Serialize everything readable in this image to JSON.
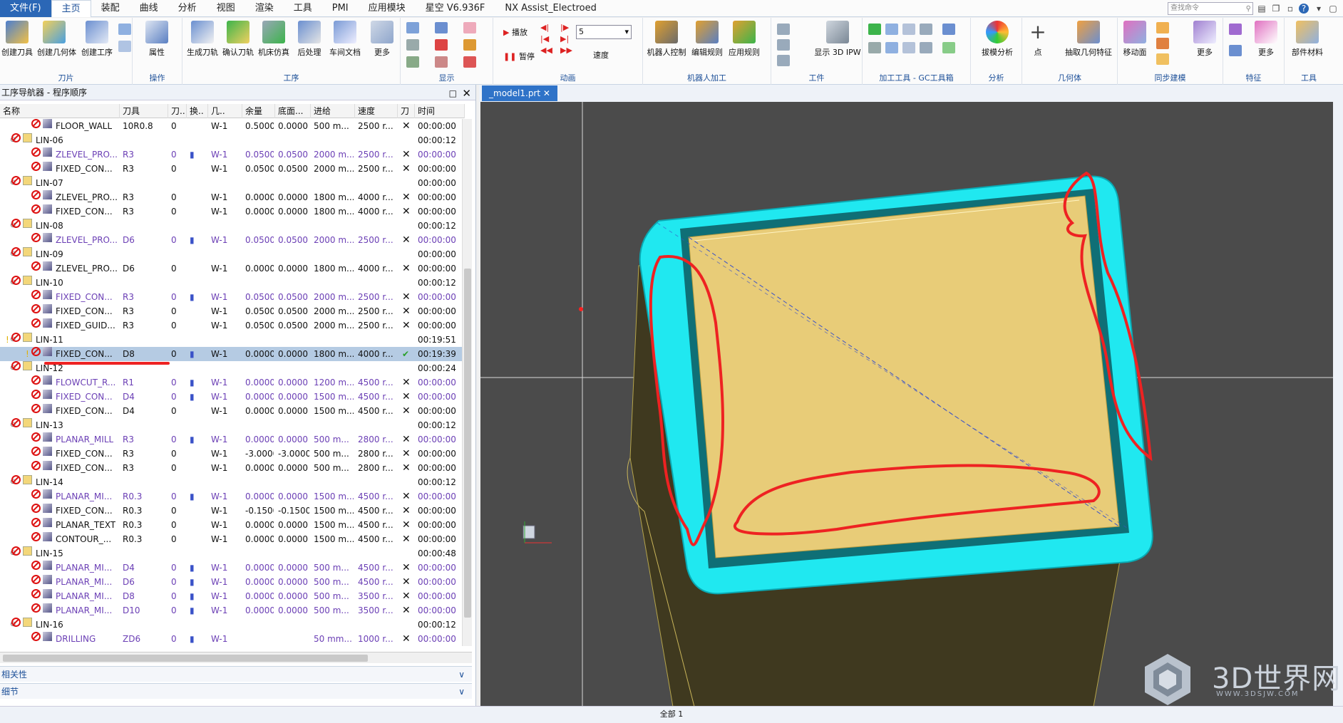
{
  "menubar": {
    "file": "文件(F)",
    "tabs": [
      "主页",
      "装配",
      "曲线",
      "分析",
      "视图",
      "渲染",
      "工具",
      "PMI",
      "应用模块",
      "星空 V6.936F",
      "NX Assist_Electroed"
    ],
    "search_placeholder": "查找命令"
  },
  "ribbon": {
    "groups": [
      {
        "label": "刀片",
        "buttons": [
          "创建刀具",
          "创建几何体",
          "创建工序"
        ]
      },
      {
        "label": "操作",
        "buttons": [
          "属性"
        ]
      },
      {
        "label": "工序",
        "buttons": [
          "生成刀轨",
          "确认刀轨",
          "机床仿真",
          "后处理",
          "车间文档",
          "更多"
        ]
      },
      {
        "label": "显示",
        "buttons": []
      },
      {
        "label": "动画",
        "buttons": [
          "播放",
          "暂停",
          "速度"
        ],
        "speed_value": "5"
      },
      {
        "label": "机器人加工",
        "buttons": [
          "机器人控制",
          "编辑规则",
          "应用规则"
        ]
      },
      {
        "label": "工件",
        "buttons": [
          "显示 3D IPW"
        ]
      },
      {
        "label": "加工工具 - GC工具箱",
        "buttons": []
      },
      {
        "label": "分析",
        "buttons": [
          "拔模分析"
        ]
      },
      {
        "label": "几何体",
        "buttons": [
          "点",
          "抽取几何特征"
        ]
      },
      {
        "label": "同步建模",
        "buttons": [
          "移动面",
          "更多"
        ]
      },
      {
        "label": "特征",
        "buttons": [
          "更多"
        ]
      },
      {
        "label": "工具",
        "buttons": [
          "部件材料"
        ]
      }
    ]
  },
  "navigator": {
    "title": "工序导航器 - 程序顺序",
    "columns": [
      "名称",
      "刀具",
      "刀..",
      "换..",
      "几..",
      "余量",
      "底面...",
      "进给",
      "速度",
      "刀",
      "时间"
    ],
    "rows": [
      {
        "level": 2,
        "name": "FLOOR_WALL",
        "tool": "10R0.8",
        "num": "0",
        "chg": "",
        "geo": "W-1",
        "stock": "0.5000",
        "floor": "0.0000",
        "feed": "500 m...",
        "speed": "2500 r...",
        "path": "x",
        "time": "00:00:00",
        "purple": false
      },
      {
        "level": 1,
        "name": "LIN-06",
        "time": "00:00:12"
      },
      {
        "level": 2,
        "name": "ZLEVEL_PRO...",
        "tool": "R3",
        "num": "0",
        "chg": "▮",
        "geo": "W-1",
        "stock": "0.0500",
        "floor": "0.0500",
        "feed": "2000 m...",
        "speed": "2500 r...",
        "path": "x",
        "time": "00:00:00",
        "purple": true
      },
      {
        "level": 2,
        "name": "FIXED_CON...",
        "tool": "R3",
        "num": "0",
        "chg": "",
        "geo": "W-1",
        "stock": "0.0500",
        "floor": "0.0500",
        "feed": "2000 m...",
        "speed": "2500 r...",
        "path": "x",
        "time": "00:00:00",
        "purple": false
      },
      {
        "level": 1,
        "name": "LIN-07",
        "time": "00:00:00"
      },
      {
        "level": 2,
        "name": "ZLEVEL_PRO...",
        "tool": "R3",
        "num": "0",
        "chg": "",
        "geo": "W-1",
        "stock": "0.0000",
        "floor": "0.0000",
        "feed": "1800 m...",
        "speed": "4000 r...",
        "path": "x",
        "time": "00:00:00",
        "purple": false
      },
      {
        "level": 2,
        "name": "FIXED_CON...",
        "tool": "R3",
        "num": "0",
        "chg": "",
        "geo": "W-1",
        "stock": "0.0000",
        "floor": "0.0000",
        "feed": "1800 m...",
        "speed": "4000 r...",
        "path": "x",
        "time": "00:00:00",
        "purple": false
      },
      {
        "level": 1,
        "name": "LIN-08",
        "time": "00:00:12"
      },
      {
        "level": 2,
        "name": "ZLEVEL_PRO...",
        "tool": "D6",
        "num": "0",
        "chg": "▮",
        "geo": "W-1",
        "stock": "0.0500",
        "floor": "0.0500",
        "feed": "2000 m...",
        "speed": "2500 r...",
        "path": "x",
        "time": "00:00:00",
        "purple": true
      },
      {
        "level": 1,
        "name": "LIN-09",
        "time": "00:00:00"
      },
      {
        "level": 2,
        "name": "ZLEVEL_PRO...",
        "tool": "D6",
        "num": "0",
        "chg": "",
        "geo": "W-1",
        "stock": "0.0000",
        "floor": "0.0000",
        "feed": "1800 m...",
        "speed": "4000 r...",
        "path": "x",
        "time": "00:00:00",
        "purple": false
      },
      {
        "level": 1,
        "name": "LIN-10",
        "time": "00:00:12"
      },
      {
        "level": 2,
        "name": "FIXED_CON...",
        "tool": "R3",
        "num": "0",
        "chg": "▮",
        "geo": "W-1",
        "stock": "0.0500",
        "floor": "0.0500",
        "feed": "2000 m...",
        "speed": "2500 r...",
        "path": "x",
        "time": "00:00:00",
        "purple": true
      },
      {
        "level": 2,
        "name": "FIXED_CON...",
        "tool": "R3",
        "num": "0",
        "chg": "",
        "geo": "W-1",
        "stock": "0.0500",
        "floor": "0.0500",
        "feed": "2000 m...",
        "speed": "2500 r...",
        "path": "x",
        "time": "00:00:00",
        "purple": false
      },
      {
        "level": 2,
        "name": "FIXED_GUID...",
        "tool": "R3",
        "num": "0",
        "chg": "",
        "geo": "W-1",
        "stock": "0.0500",
        "floor": "0.0500",
        "feed": "2000 m...",
        "speed": "2500 r...",
        "path": "x",
        "time": "00:00:00",
        "purple": false
      },
      {
        "level": 1,
        "name": "LIN-11",
        "time": "00:19:51",
        "warn": true
      },
      {
        "level": 2,
        "name": "FIXED_CON...",
        "tool": "D8",
        "num": "0",
        "chg": "▮",
        "geo": "W-1",
        "stock": "0.0000",
        "floor": "0.0000",
        "feed": "1800 m...",
        "speed": "4000 r...",
        "path": "ok",
        "time": "00:19:39",
        "purple": false,
        "selected": true,
        "warn": true
      },
      {
        "level": 1,
        "name": "LIN-12",
        "time": "00:00:24"
      },
      {
        "level": 2,
        "name": "FLOWCUT_R...",
        "tool": "R1",
        "num": "0",
        "chg": "▮",
        "geo": "W-1",
        "stock": "0.0000",
        "floor": "0.0000",
        "feed": "1200 m...",
        "speed": "4500 r...",
        "path": "x",
        "time": "00:00:00",
        "purple": true
      },
      {
        "level": 2,
        "name": "FIXED_CON...",
        "tool": "D4",
        "num": "0",
        "chg": "▮",
        "geo": "W-1",
        "stock": "0.0000",
        "floor": "0.0000",
        "feed": "1500 m...",
        "speed": "4500 r...",
        "path": "x",
        "time": "00:00:00",
        "purple": true
      },
      {
        "level": 2,
        "name": "FIXED_CON...",
        "tool": "D4",
        "num": "0",
        "chg": "",
        "geo": "W-1",
        "stock": "0.0000",
        "floor": "0.0000",
        "feed": "1500 m...",
        "speed": "4500 r...",
        "path": "x",
        "time": "00:00:00",
        "purple": false
      },
      {
        "level": 1,
        "name": "LIN-13",
        "time": "00:00:12"
      },
      {
        "level": 2,
        "name": "PLANAR_MILL",
        "tool": "R3",
        "num": "0",
        "chg": "▮",
        "geo": "W-1",
        "stock": "0.0000",
        "floor": "0.0000",
        "feed": "500 m...",
        "speed": "2800 r...",
        "path": "x",
        "time": "00:00:00",
        "purple": true
      },
      {
        "level": 2,
        "name": "FIXED_CON...",
        "tool": "R3",
        "num": "0",
        "chg": "",
        "geo": "W-1",
        "stock": "-3.0000",
        "floor": "-3.0000",
        "feed": "500 m...",
        "speed": "2800 r...",
        "path": "x",
        "time": "00:00:00",
        "purple": false
      },
      {
        "level": 2,
        "name": "FIXED_CON...",
        "tool": "R3",
        "num": "0",
        "chg": "",
        "geo": "W-1",
        "stock": "0.0000",
        "floor": "0.0000",
        "feed": "500 m...",
        "speed": "2800 r...",
        "path": "x",
        "time": "00:00:00",
        "purple": false
      },
      {
        "level": 1,
        "name": "LIN-14",
        "time": "00:00:12"
      },
      {
        "level": 2,
        "name": "PLANAR_MI...",
        "tool": "R0.3",
        "num": "0",
        "chg": "▮",
        "geo": "W-1",
        "stock": "0.0000",
        "floor": "0.0000",
        "feed": "1500 m...",
        "speed": "4500 r...",
        "path": "x",
        "time": "00:00:00",
        "purple": true
      },
      {
        "level": 2,
        "name": "FIXED_CON...",
        "tool": "R0.3",
        "num": "0",
        "chg": "",
        "geo": "W-1",
        "stock": "-0.1500",
        "floor": "-0.1500",
        "feed": "1500 m...",
        "speed": "4500 r...",
        "path": "x",
        "time": "00:00:00",
        "purple": false
      },
      {
        "level": 2,
        "name": "PLANAR_TEXT",
        "tool": "R0.3",
        "num": "0",
        "chg": "",
        "geo": "W-1",
        "stock": "0.0000",
        "floor": "0.0000",
        "feed": "1500 m...",
        "speed": "4500 r...",
        "path": "x",
        "time": "00:00:00",
        "purple": false
      },
      {
        "level": 2,
        "name": "CONTOUR_...",
        "tool": "R0.3",
        "num": "0",
        "chg": "",
        "geo": "W-1",
        "stock": "0.0000",
        "floor": "0.0000",
        "feed": "1500 m...",
        "speed": "4500 r...",
        "path": "x",
        "time": "00:00:00",
        "purple": false
      },
      {
        "level": 1,
        "name": "LIN-15",
        "time": "00:00:48"
      },
      {
        "level": 2,
        "name": "PLANAR_MI...",
        "tool": "D4",
        "num": "0",
        "chg": "▮",
        "geo": "W-1",
        "stock": "0.0000",
        "floor": "0.0000",
        "feed": "500 m...",
        "speed": "4500 r...",
        "path": "x",
        "time": "00:00:00",
        "purple": true
      },
      {
        "level": 2,
        "name": "PLANAR_MI...",
        "tool": "D6",
        "num": "0",
        "chg": "▮",
        "geo": "W-1",
        "stock": "0.0000",
        "floor": "0.0000",
        "feed": "500 m...",
        "speed": "4500 r...",
        "path": "x",
        "time": "00:00:00",
        "purple": true
      },
      {
        "level": 2,
        "name": "PLANAR_MI...",
        "tool": "D8",
        "num": "0",
        "chg": "▮",
        "geo": "W-1",
        "stock": "0.0000",
        "floor": "0.0000",
        "feed": "500 m...",
        "speed": "3500 r...",
        "path": "x",
        "time": "00:00:00",
        "purple": true
      },
      {
        "level": 2,
        "name": "PLANAR_MI...",
        "tool": "D10",
        "num": "0",
        "chg": "▮",
        "geo": "W-1",
        "stock": "0.0000",
        "floor": "0.0000",
        "feed": "500 m...",
        "speed": "3500 r...",
        "path": "x",
        "time": "00:00:00",
        "purple": true
      },
      {
        "level": 1,
        "name": "LIN-16",
        "time": "00:00:12"
      },
      {
        "level": 2,
        "name": "DRILLING",
        "tool": "ZD6",
        "num": "0",
        "chg": "▮",
        "geo": "W-1",
        "stock": "",
        "floor": "",
        "feed": "50 mm...",
        "speed": "1000 r...",
        "path": "x",
        "time": "00:00:00",
        "purple": true
      }
    ],
    "sections": [
      "相关性",
      "细节"
    ]
  },
  "document": {
    "tab": "_model1.prt"
  },
  "status": {
    "text": "全部 1"
  },
  "watermark": {
    "text": "3D世界网",
    "url": "WWW.3DSJW.COM"
  },
  "colors": {
    "accent": "#2b67b6",
    "toolpath": "#20e8f0",
    "part": "#e8cc78",
    "annotation": "#ee2222",
    "viewport_bg": "#4b4b4b"
  }
}
